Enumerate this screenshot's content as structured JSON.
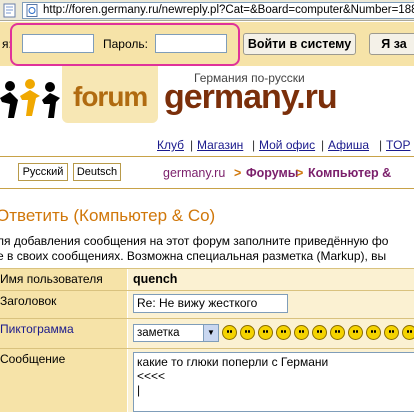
{
  "browser": {
    "url": "http://foren.germany.ru/newreply.pl?Cat=&Board=computer&Number=188"
  },
  "login": {
    "user_label": "я:",
    "password_label": "Пароль:",
    "login_button": "Войти в систему",
    "register_button": "Я за"
  },
  "header": {
    "tagline": "Германия по-русски",
    "forum_logo": "forum",
    "site_logo": "germany.ru"
  },
  "nav": {
    "links": [
      "Клуб",
      "Магазин",
      "Мой офис",
      "Афиша",
      "TOP"
    ]
  },
  "lang": {
    "ru": "Русский",
    "de": "Deutsch"
  },
  "breadcrumb": {
    "site": "germany.ru",
    "sep1": ">",
    "forums": "Форумы",
    "sep2": ">",
    "board": "Компьютер &"
  },
  "reply": {
    "title": "Ответить (Компьютер & Co)",
    "desc1": "ля добавления сообщения на этот форум заполните приведённую фо",
    "desc2": "е в своих сообщениях. Возможна специальная разметка (Markup), вы"
  },
  "form": {
    "username_label": "Имя пользователя",
    "username_value": "quench",
    "subject_label": "Заголовок",
    "subject_value": "Re: Не вижу жесткого",
    "icon_label": "Пиктограмма",
    "icon_value": "заметка",
    "message_label": "Сообщение",
    "message_value": "какие то глюки поперли с Германи\n<<<<\n|"
  },
  "colors": {
    "accent": "#d0770a",
    "highlight": "#e0329a",
    "link": "#1a1a8c",
    "breadcrumb": "#7b1f6b"
  }
}
